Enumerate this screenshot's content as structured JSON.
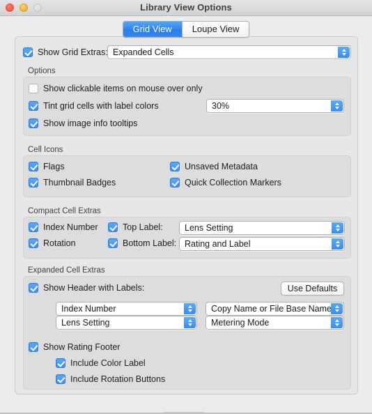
{
  "window": {
    "title": "Library View Options",
    "traffic_lights": [
      {
        "name": "close",
        "color": "#f25d54"
      },
      {
        "name": "minimize",
        "color": "#f7b637"
      },
      {
        "name": "zoom",
        "color": "#dcdcdc"
      }
    ]
  },
  "tabs": [
    {
      "label": "Grid View",
      "selected": true
    },
    {
      "label": "Loupe View",
      "selected": false
    }
  ],
  "grid_view": {
    "show_grid_extras": {
      "label": "Show Grid Extras:",
      "checked": true,
      "value": "Expanded Cells"
    },
    "options": {
      "title": "Options",
      "show_clickable_items": {
        "label": "Show clickable items on mouse over only",
        "checked": false
      },
      "tint_grid_cells": {
        "label": "Tint grid cells with label colors",
        "checked": true,
        "value": "30%"
      },
      "show_image_info_tooltips": {
        "label": "Show image info tooltips",
        "checked": true
      }
    },
    "cell_icons": {
      "title": "Cell Icons",
      "items": [
        {
          "label": "Flags",
          "checked": true
        },
        {
          "label": "Unsaved Metadata",
          "checked": true
        },
        {
          "label": "Thumbnail Badges",
          "checked": true
        },
        {
          "label": "Quick Collection Markers",
          "checked": true
        }
      ]
    },
    "compact_cell_extras": {
      "title": "Compact Cell Extras",
      "index_number": {
        "label": "Index Number",
        "checked": true
      },
      "rotation": {
        "label": "Rotation",
        "checked": true
      },
      "top_label": {
        "label": "Top Label:",
        "checked": true,
        "value": "Lens Setting"
      },
      "bottom_label": {
        "label": "Bottom Label:",
        "checked": true,
        "value": "Rating and Label"
      }
    },
    "expanded_cell_extras": {
      "title": "Expanded Cell Extras",
      "show_header_with_labels": {
        "label": "Show Header with Labels:",
        "checked": true
      },
      "use_defaults_button": "Use Defaults",
      "header_fields": [
        "Index Number",
        "Copy Name or File Base Name",
        "Lens Setting",
        "Metering Mode"
      ],
      "show_rating_footer": {
        "label": "Show Rating Footer",
        "checked": true
      },
      "include_color_label": {
        "label": "Include Color Label",
        "checked": true
      },
      "include_rotation_buttons": {
        "label": "Include Rotation Buttons",
        "checked": true
      }
    }
  }
}
